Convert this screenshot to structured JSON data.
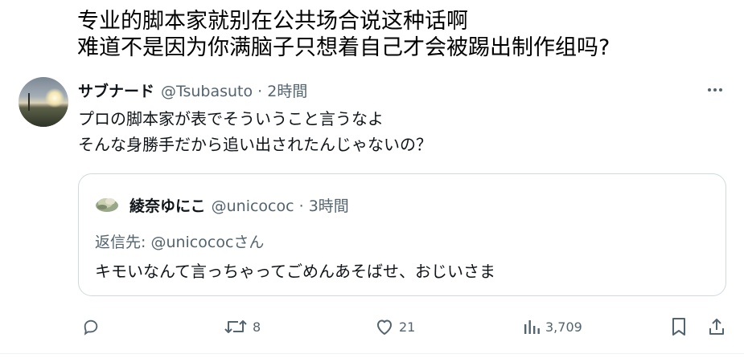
{
  "caption": {
    "line1": "专业的脚本家就别在公共场合说这种话啊",
    "line2": "难道不是因为你满脑子只想着自己才会被踢出制作组吗?"
  },
  "tweet": {
    "display_name": "サブナード",
    "handle_time": "@Tsubasuto · 2時間",
    "text_line1": "プロの脚本家が表でそういうこと言うなよ",
    "text_line2": "そんな身勝手だから追い出されたんじゃないの？",
    "more_icon": "more-horizontal-icon"
  },
  "quote": {
    "display_name": "綾奈ゆにこ",
    "handle_time": "@unicococ · 3時間",
    "reply_to": "返信先: @unicococさん",
    "text": "キモいなんて言っちゃってごめんあそばせ、おじいさま"
  },
  "actions": {
    "reply_count": "",
    "retweet_count": "8",
    "like_count": "21",
    "views_count": "3,709"
  },
  "colors": {
    "text_primary": "#0f1419",
    "text_secondary": "#536471",
    "border": "#cfd9de"
  }
}
